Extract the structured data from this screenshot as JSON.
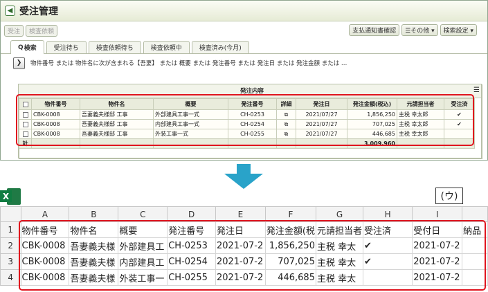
{
  "app": {
    "back_icon": "back-arrow-icon",
    "title": "受注管理"
  },
  "toolbar": {
    "left": [
      "受注",
      "検査依頼"
    ],
    "right": [
      "支払通知書確認",
      "☰その他 ▾",
      "検索設定 ▾"
    ]
  },
  "tabs": [
    "検索",
    "受注待ち",
    "検査依頼待ち",
    "検査依頼中",
    "検査済み(今月)"
  ],
  "search": {
    "expand_icon": "chevron-right-icon",
    "condition": "物件番号 または 物件名に次が含まれる【吾妻】 または 概要 または 発注番号 または 発注日 または 発注金額 または …"
  },
  "grid": {
    "group_header": "発注内容",
    "columns": [
      "物件番号",
      "物件名",
      "概要",
      "発注番号",
      "詳細",
      "発注日",
      "発注金額(税込)",
      "元請担当者",
      "受注済"
    ],
    "rows": [
      {
        "no": "CBK-0008",
        "name": "吾妻義夫様邸 工事",
        "summary": "外部建具工事一式",
        "order_no": "CH-0253",
        "date": "2021/07/27",
        "amount": "1,856,250",
        "person": "主税 幸太郎",
        "done": "✔"
      },
      {
        "no": "CBK-0008",
        "name": "吾妻義夫様邸 工事",
        "summary": "内部建具工事一式",
        "order_no": "CH-0254",
        "date": "2021/07/27",
        "amount": "707,025",
        "person": "主税 幸太郎",
        "done": "✔"
      },
      {
        "no": "CBK-0008",
        "name": "吾妻義夫様邸 工事",
        "summary": "外装工事一式",
        "order_no": "CH-0255",
        "date": "2021/07/27",
        "amount": "446,685",
        "person": "主税 幸太郎",
        "done": ""
      }
    ],
    "total_label": "計",
    "total_amount": "3,009,960"
  },
  "excel": {
    "icon_letter": "X",
    "label": "(ウ)",
    "col_letters": [
      "A",
      "B",
      "C",
      "D",
      "E",
      "F",
      "G",
      "H",
      "I"
    ],
    "header_row": [
      "物件番号",
      "物件名",
      "概要",
      "発注番号",
      "発注日",
      "発注金額(税",
      "元請担当者",
      "受注済",
      "受付日",
      "納品"
    ],
    "rows": [
      {
        "n": "2",
        "cells": [
          "CBK-0008",
          "吾妻義夫様",
          "外部建具工",
          "CH-0253",
          "2021-07-2",
          "1,856,250",
          "主税 幸太",
          "✔",
          "2021-07-2",
          ""
        ]
      },
      {
        "n": "3",
        "cells": [
          "CBK-0008",
          "吾妻義夫様",
          "内部建具工",
          "CH-0254",
          "2021-07-2",
          "707,025",
          "主税 幸太",
          "✔",
          "2021-07-2",
          ""
        ]
      },
      {
        "n": "4",
        "cells": [
          "CBK-0008",
          "吾妻義夫様",
          "外装工事一",
          "CH-0255",
          "2021-07-2",
          "446,685",
          "主税 幸太",
          "",
          "2021-07-2",
          ""
        ]
      }
    ]
  },
  "colors": {
    "highlight": "#e0141e",
    "arrow": "#29a3c9",
    "excel_green": "#107c41"
  }
}
